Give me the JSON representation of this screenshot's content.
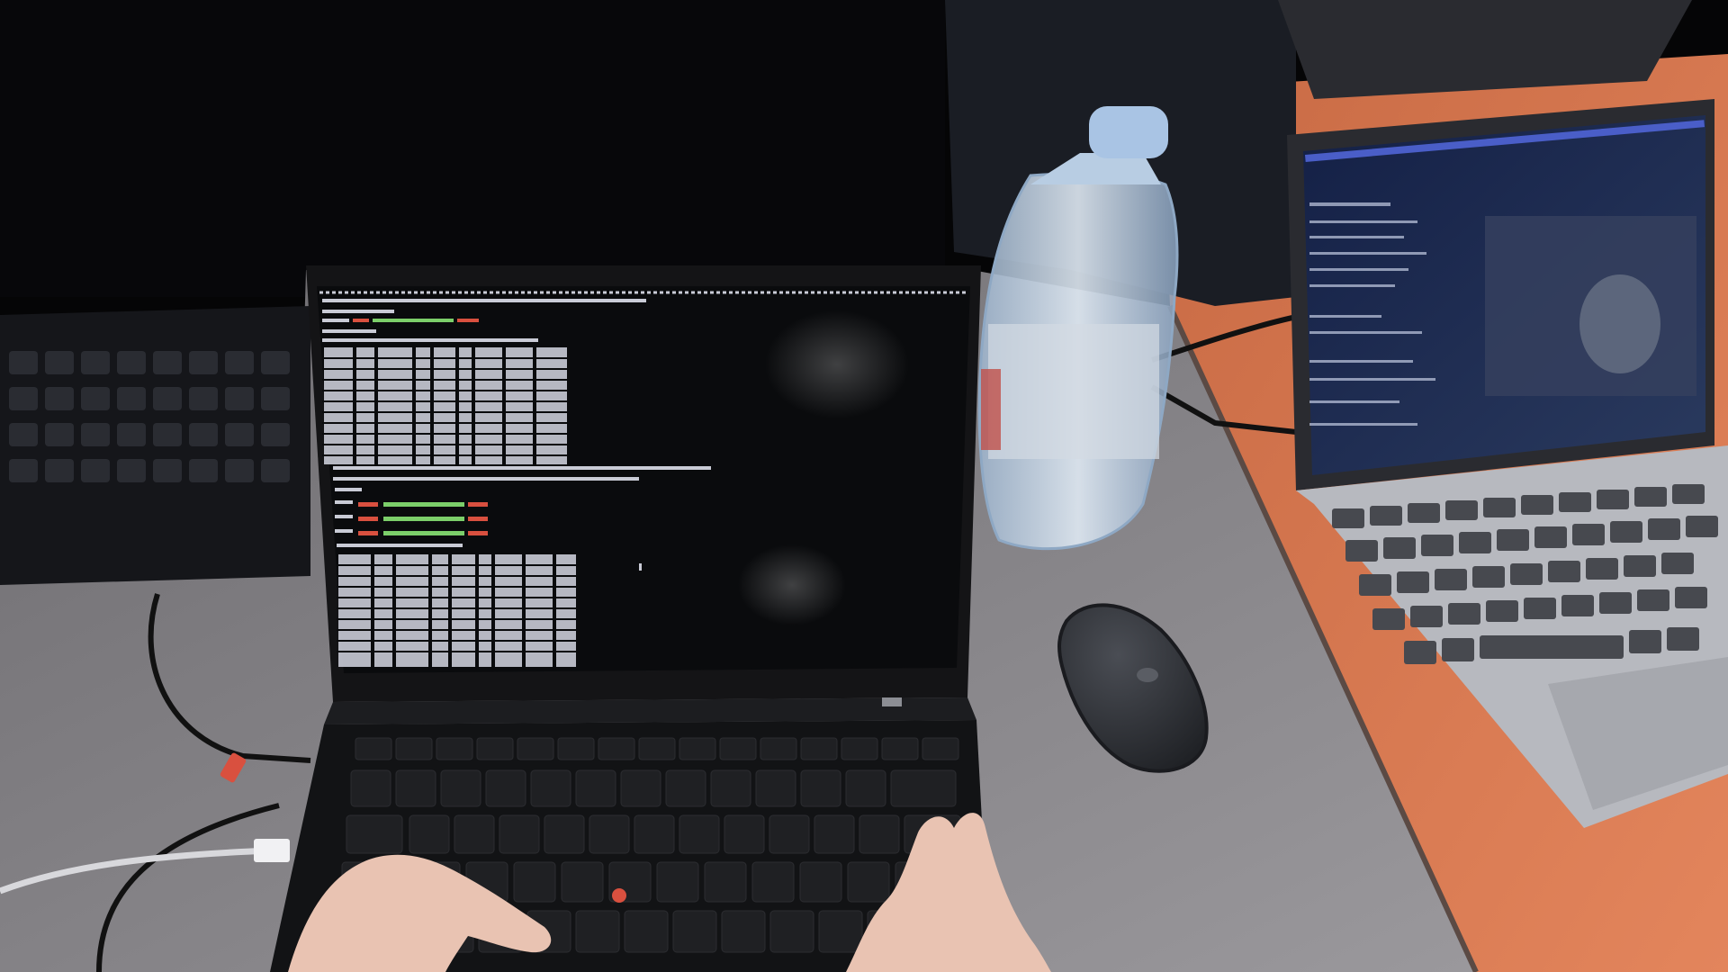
{
  "scene": {
    "description_free": true,
    "colors": {
      "background_dark": "#050506",
      "desk_gray": "#8c8a8e",
      "desk_orange": "#d9764f",
      "laptop_black": "#141416",
      "terminal_bg": "#0a0b0d",
      "terminal_text": "#c9cbd6",
      "terminal_green": "#7ccf6a",
      "terminal_red": "#d9503f",
      "bottle_cap": "#a9c4e4",
      "macbook_silver": "#b7b9bf",
      "macbook_screen": "#1b2a52",
      "mouse_dark": "#2c2e33",
      "skin": "#e9c3b2"
    },
    "icons": {
      "trackpoint": "trackpoint-icon",
      "mouse": "mouse-icon",
      "bottle": "water-bottle-icon"
    }
  }
}
